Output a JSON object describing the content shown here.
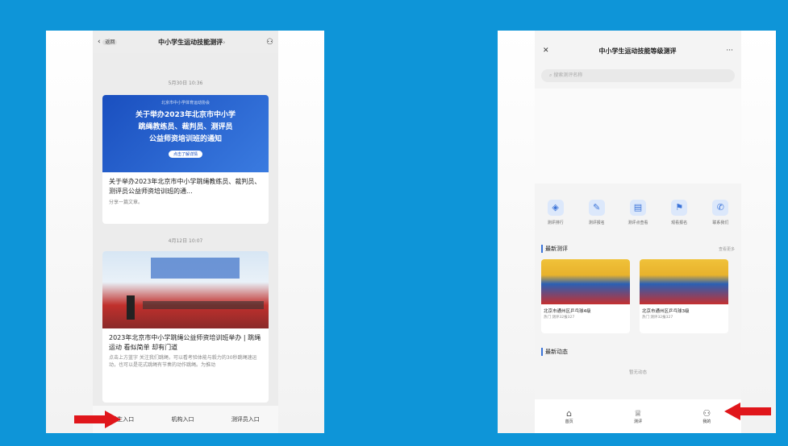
{
  "left_phone": {
    "header": {
      "back_label": "返回",
      "title": "中小学生运动技能测评",
      "title_suffix": "›"
    },
    "timestamp1": "5月30日 10:36",
    "article1": {
      "banner_top": "北京市中小学体育运动协会",
      "banner_title_line1": "关于举办2023年北京市中小学",
      "banner_title_line2": "跳绳教练员、裁判员、测评员",
      "banner_title_line3": "公益师资培训班的通知",
      "banner_button": "点击了解详情",
      "title": "关于举办2023年北京市中小学跳绳教练员、裁判员、测评员公益师资培训班的通...",
      "sub": "分享一篇文章。"
    },
    "timestamp2": "4月12日 10:07",
    "article2": {
      "title": "2023年北京市中小学跳绳公益师资培训班举办 | 跳绳运动 看似简单 却有门道",
      "desc": "点击上方蓝字 关注我们跳绳，可以看考验体能与毅力的30秒跳绳速运动，也可以是花式跳绳有节奏的动作跳绳。为推动"
    },
    "tabs": [
      "学生入口",
      "机构入口",
      "测评员入口"
    ]
  },
  "right_phone": {
    "header": {
      "close": "✕",
      "title": "中小学生运动技能等级测评",
      "more": "···"
    },
    "search_placeholder": "搜索测评名称",
    "icons": [
      {
        "icon": "shield-icon",
        "label": "测评排行"
      },
      {
        "icon": "edit-icon",
        "label": "测评报名"
      },
      {
        "icon": "clipboard-icon",
        "label": "测评点查看"
      },
      {
        "icon": "flag-icon",
        "label": "观看报名"
      },
      {
        "icon": "phone-icon",
        "label": "联系我们"
      }
    ],
    "section1": {
      "title": "最新测评",
      "more": "查看更多"
    },
    "events": [
      {
        "name": "北京市通州区乒乓球4级",
        "sub": "热门 测评32报327"
      },
      {
        "name": "北京市通州区乒乓球3级",
        "sub": "热门 测评32报327"
      }
    ],
    "section2": {
      "title": "最新动态",
      "empty": "暂无动态"
    },
    "tabs": [
      "首页",
      "测评",
      "我的"
    ]
  },
  "colors": {
    "background": "#0e95d8",
    "arrow": "#e0161b",
    "banner": "#1a4fbf"
  }
}
